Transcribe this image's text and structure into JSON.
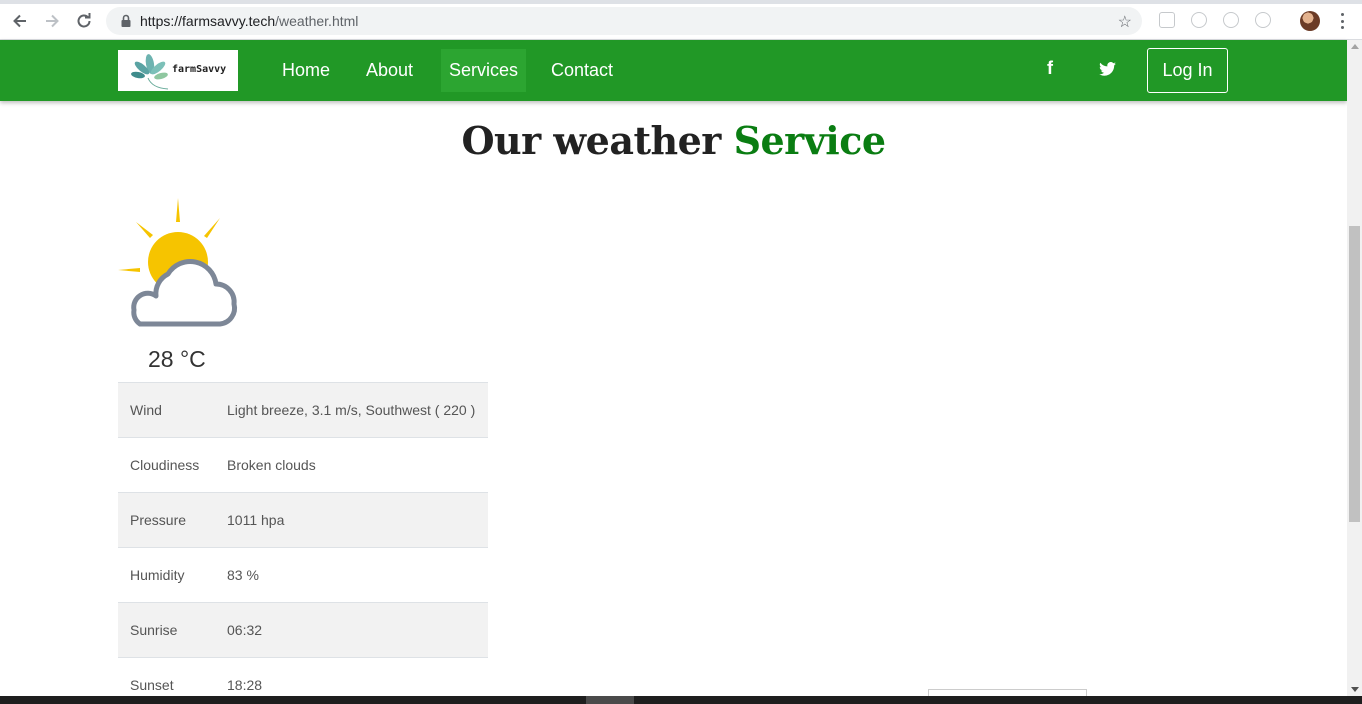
{
  "browser": {
    "url_host": "https://farmsavvy.tech",
    "url_path": "/weather.html"
  },
  "nav": {
    "logo_text": "farmSavvy",
    "links": [
      {
        "label": "Home"
      },
      {
        "label": "About"
      },
      {
        "label": "Services"
      },
      {
        "label": "Contact"
      }
    ],
    "active_link": "Services",
    "social": {
      "facebook": "f",
      "twitter_icon": "twitter-icon"
    },
    "login_label": "Log In",
    "brand_color": "#219826"
  },
  "page": {
    "title_main": "Our weather",
    "title_accent": "Service",
    "accent_color": "#0a7d12"
  },
  "weather": {
    "icon": "partly-cloudy-icon",
    "temperature": "28 °C",
    "rows": [
      {
        "key": "Wind",
        "value": "Light breeze, 3.1 m/s, Southwest ( 220 )"
      },
      {
        "key": "Cloudiness",
        "value": "Broken clouds"
      },
      {
        "key": "Pressure",
        "value": "1011 hpa"
      },
      {
        "key": "Humidity",
        "value": "83 %"
      },
      {
        "key": "Sunrise",
        "value": "06:32"
      },
      {
        "key": "Sunset",
        "value": "18:28"
      }
    ]
  }
}
